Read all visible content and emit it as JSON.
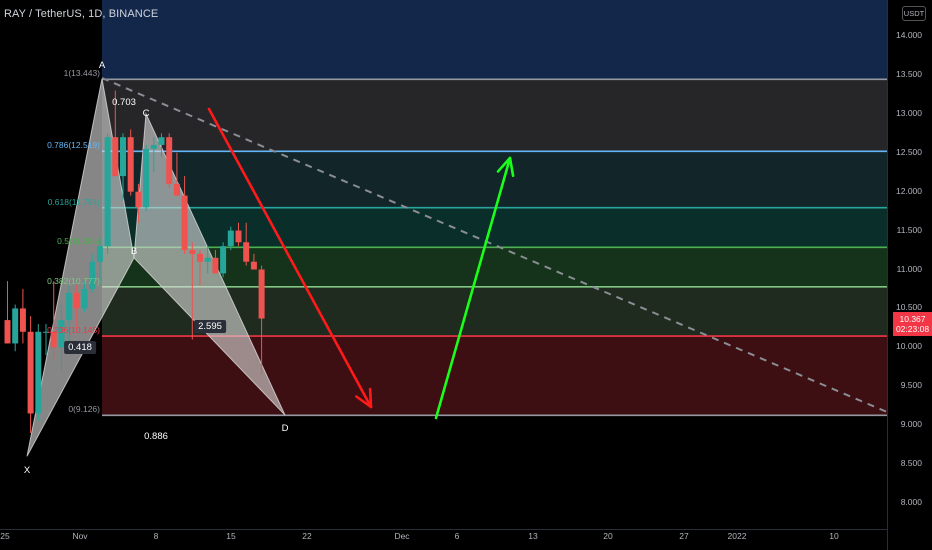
{
  "header": {
    "title": "RAY / TetherUS, 1D, BINANCE",
    "currency_badge": "USDT"
  },
  "price_axis": {
    "ticks": [
      "14.000",
      "13.500",
      "13.000",
      "12.500",
      "12.000",
      "11.500",
      "11.000",
      "10.500",
      "10.000",
      "9.500",
      "9.000",
      "8.500",
      "8.000"
    ],
    "last_price": "10.367",
    "countdown": "02:23:08",
    "last_price_color": "#f23645"
  },
  "time_axis": {
    "ticks": [
      "25",
      "Nov",
      "8",
      "15",
      "22",
      "Dec",
      "6",
      "13",
      "20",
      "27",
      "2022",
      "10"
    ]
  },
  "fib_levels": [
    {
      "label": "1(13.443)",
      "price": 13.443,
      "color": "#9598a1"
    },
    {
      "label": "0.786(12.519)",
      "price": 12.519,
      "color": "#64b5f6"
    },
    {
      "label": "0.618(11.794)",
      "price": 11.794,
      "color": "#26a69a"
    },
    {
      "label": "0.5(11.285)",
      "price": 11.285,
      "color": "#4caf50"
    },
    {
      "label": "0.382(10.777)",
      "price": 10.777,
      "color": "#81c784"
    },
    {
      "label": "0.236(10.145)",
      "price": 10.145,
      "color": "#f23645"
    },
    {
      "label": "0(9.126)",
      "price": 9.126,
      "color": "#9598a1"
    }
  ],
  "pattern_points": {
    "x_label": "X",
    "a_label": "A",
    "b_label": "B",
    "c_label": "C",
    "d_label": "D"
  },
  "pattern_ratios": {
    "ab": "0.703",
    "xb": "0.418",
    "bc": "0.886",
    "cd": "2.595"
  },
  "colors": {
    "up_candle": "#26a69a",
    "down_candle": "#ef5350",
    "forecast_down_arrow": "#ff1a1a",
    "forecast_up_arrow": "#1aff1a",
    "trendline": "#8a8d94",
    "pattern_fill": "#d9d9d9"
  },
  "chart_data": {
    "type": "candlestick",
    "title": "RAY / TetherUS, 1D, BINANCE",
    "ylim": [
      7.7,
      14.4
    ],
    "x_axis": [
      "25",
      "Nov",
      "8",
      "15",
      "22",
      "Dec",
      "6",
      "13",
      "20",
      "27",
      "2022",
      "10"
    ],
    "harmonic_pattern": {
      "X": 8.6,
      "A": 13.45,
      "B": 11.15,
      "C": 13.0,
      "D": 9.13
    },
    "candles": [
      {
        "o": 10.35,
        "h": 10.85,
        "l": 10.05,
        "c": 10.05
      },
      {
        "o": 10.05,
        "h": 10.55,
        "l": 9.95,
        "c": 10.5
      },
      {
        "o": 10.5,
        "h": 10.75,
        "l": 10.05,
        "c": 10.2
      },
      {
        "o": 10.2,
        "h": 10.4,
        "l": 8.9,
        "c": 9.15
      },
      {
        "o": 9.15,
        "h": 10.3,
        "l": 9.05,
        "c": 10.2
      },
      {
        "o": 10.2,
        "h": 10.3,
        "l": 9.9,
        "c": 10.2
      },
      {
        "o": 10.2,
        "h": 10.85,
        "l": 9.85,
        "c": 10.0
      },
      {
        "o": 10.0,
        "h": 10.55,
        "l": 9.7,
        "c": 10.35
      },
      {
        "o": 10.35,
        "h": 10.8,
        "l": 10.05,
        "c": 10.7
      },
      {
        "o": 10.7,
        "h": 10.8,
        "l": 10.25,
        "c": 10.5
      },
      {
        "o": 10.5,
        "h": 10.85,
        "l": 10.45,
        "c": 10.75
      },
      {
        "o": 10.75,
        "h": 11.2,
        "l": 10.7,
        "c": 11.1
      },
      {
        "o": 11.1,
        "h": 11.4,
        "l": 10.8,
        "c": 11.3
      },
      {
        "o": 11.3,
        "h": 12.75,
        "l": 11.2,
        "c": 12.7
      },
      {
        "o": 12.7,
        "h": 13.3,
        "l": 12.2,
        "c": 12.2
      },
      {
        "o": 12.2,
        "h": 12.75,
        "l": 11.9,
        "c": 12.7
      },
      {
        "o": 12.7,
        "h": 12.8,
        "l": 11.95,
        "c": 12.0
      },
      {
        "o": 12.0,
        "h": 12.1,
        "l": 11.6,
        "c": 11.8
      },
      {
        "o": 11.8,
        "h": 12.6,
        "l": 11.75,
        "c": 12.55
      },
      {
        "o": 12.55,
        "h": 12.7,
        "l": 12.25,
        "c": 12.6
      },
      {
        "o": 12.6,
        "h": 12.75,
        "l": 12.45,
        "c": 12.7
      },
      {
        "o": 12.7,
        "h": 12.75,
        "l": 12.05,
        "c": 12.1
      },
      {
        "o": 12.1,
        "h": 12.5,
        "l": 11.95,
        "c": 11.95
      },
      {
        "o": 11.95,
        "h": 12.2,
        "l": 11.2,
        "c": 11.25
      },
      {
        "o": 11.25,
        "h": 11.35,
        "l": 10.1,
        "c": 11.2
      },
      {
        "o": 11.2,
        "h": 11.25,
        "l": 10.8,
        "c": 11.1
      },
      {
        "o": 11.1,
        "h": 11.3,
        "l": 10.95,
        "c": 11.15
      },
      {
        "o": 11.15,
        "h": 11.25,
        "l": 10.95,
        "c": 10.95
      },
      {
        "o": 10.95,
        "h": 11.35,
        "l": 10.9,
        "c": 11.3
      },
      {
        "o": 11.3,
        "h": 11.55,
        "l": 11.25,
        "c": 11.5
      },
      {
        "o": 11.5,
        "h": 11.6,
        "l": 11.3,
        "c": 11.35
      },
      {
        "o": 11.35,
        "h": 11.6,
        "l": 11.05,
        "c": 11.1
      },
      {
        "o": 11.1,
        "h": 11.2,
        "l": 11.0,
        "c": 11.0
      },
      {
        "o": 11.0,
        "h": 11.05,
        "l": 9.65,
        "c": 10.37
      }
    ]
  }
}
